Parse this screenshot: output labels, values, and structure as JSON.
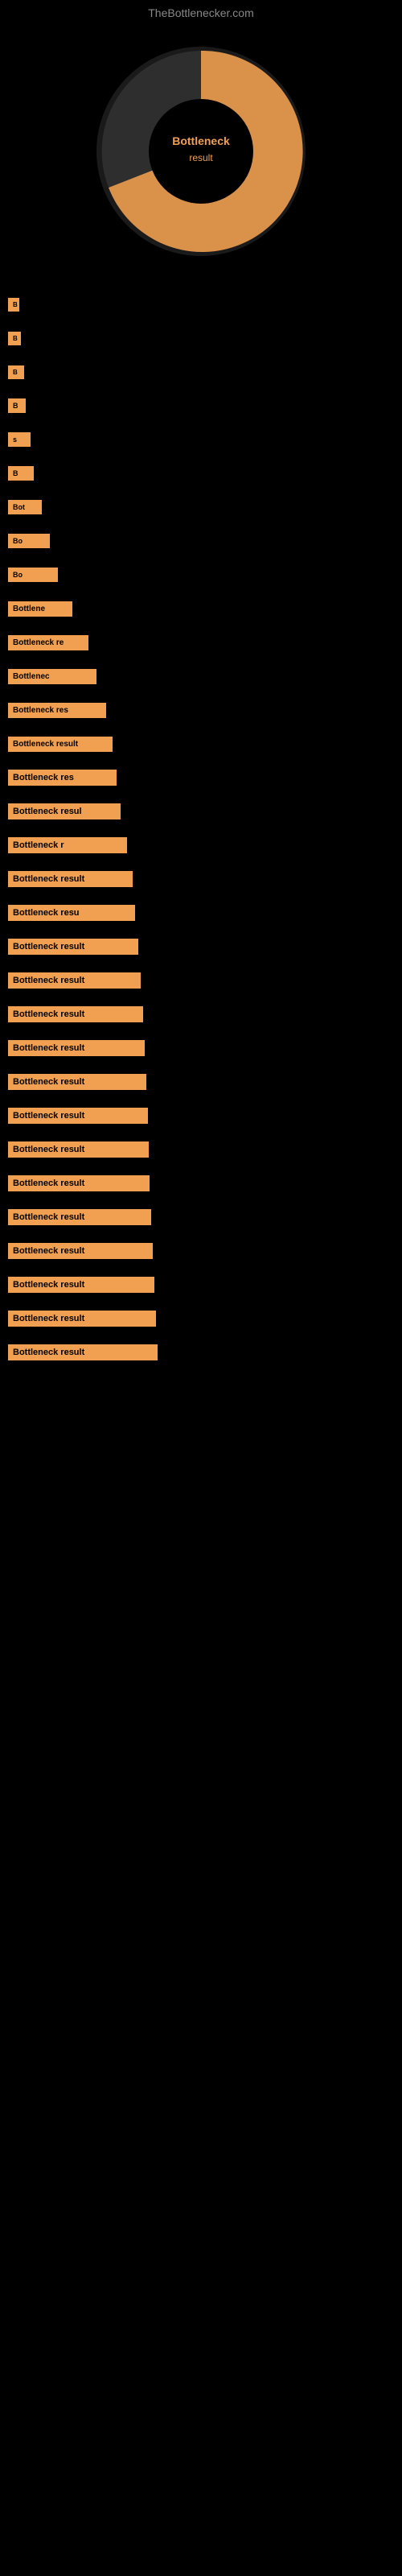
{
  "site": {
    "title": "TheBottlenecker.com"
  },
  "bottleneck_items": [
    {
      "id": 0,
      "label": "B",
      "width_class": "item-0"
    },
    {
      "id": 1,
      "label": "B",
      "width_class": "item-1"
    },
    {
      "id": 2,
      "label": "B",
      "width_class": "item-2"
    },
    {
      "id": 3,
      "label": "B",
      "width_class": "item-3"
    },
    {
      "id": 4,
      "label": "s",
      "width_class": "item-4"
    },
    {
      "id": 5,
      "label": "B",
      "width_class": "item-5"
    },
    {
      "id": 6,
      "label": "Bot",
      "width_class": "item-6"
    },
    {
      "id": 7,
      "label": "Bo",
      "width_class": "item-7"
    },
    {
      "id": 8,
      "label": "Bo",
      "width_class": "item-8"
    },
    {
      "id": 9,
      "label": "Bottlene",
      "width_class": "item-9"
    },
    {
      "id": 10,
      "label": "Bottleneck re",
      "width_class": "item-10"
    },
    {
      "id": 11,
      "label": "Bottlenec",
      "width_class": "item-11"
    },
    {
      "id": 12,
      "label": "Bottleneck res",
      "width_class": "item-12"
    },
    {
      "id": 13,
      "label": "Bottleneck result",
      "width_class": "item-13"
    },
    {
      "id": 14,
      "label": "Bottleneck res",
      "width_class": "item-14"
    },
    {
      "id": 15,
      "label": "Bottleneck resul",
      "width_class": "item-15"
    },
    {
      "id": 16,
      "label": "Bottleneck r",
      "width_class": "item-16"
    },
    {
      "id": 17,
      "label": "Bottleneck result",
      "width_class": "item-17"
    },
    {
      "id": 18,
      "label": "Bottleneck resu",
      "width_class": "item-18"
    },
    {
      "id": 19,
      "label": "Bottleneck result",
      "width_class": "item-19"
    },
    {
      "id": 20,
      "label": "Bottleneck result",
      "width_class": "item-20"
    },
    {
      "id": 21,
      "label": "Bottleneck result",
      "width_class": "item-21"
    },
    {
      "id": 22,
      "label": "Bottleneck result",
      "width_class": "item-22"
    },
    {
      "id": 23,
      "label": "Bottleneck result",
      "width_class": "item-23"
    },
    {
      "id": 24,
      "label": "Bottleneck result",
      "width_class": "item-24"
    },
    {
      "id": 25,
      "label": "Bottleneck result",
      "width_class": "item-25"
    },
    {
      "id": 26,
      "label": "Bottleneck result",
      "width_class": "item-26"
    },
    {
      "id": 27,
      "label": "Bottleneck result",
      "width_class": "item-27"
    },
    {
      "id": 28,
      "label": "Bottleneck result",
      "width_class": "item-28"
    },
    {
      "id": 29,
      "label": "Bottleneck result",
      "width_class": "item-29"
    },
    {
      "id": 30,
      "label": "Bottleneck result",
      "width_class": "item-30"
    },
    {
      "id": 31,
      "label": "Bottleneck result",
      "width_class": "item-31"
    }
  ],
  "chart": {
    "colors": {
      "orange": "#f0a050",
      "dark_orange": "#d4822a",
      "gray": "#888888",
      "black": "#000000"
    }
  }
}
